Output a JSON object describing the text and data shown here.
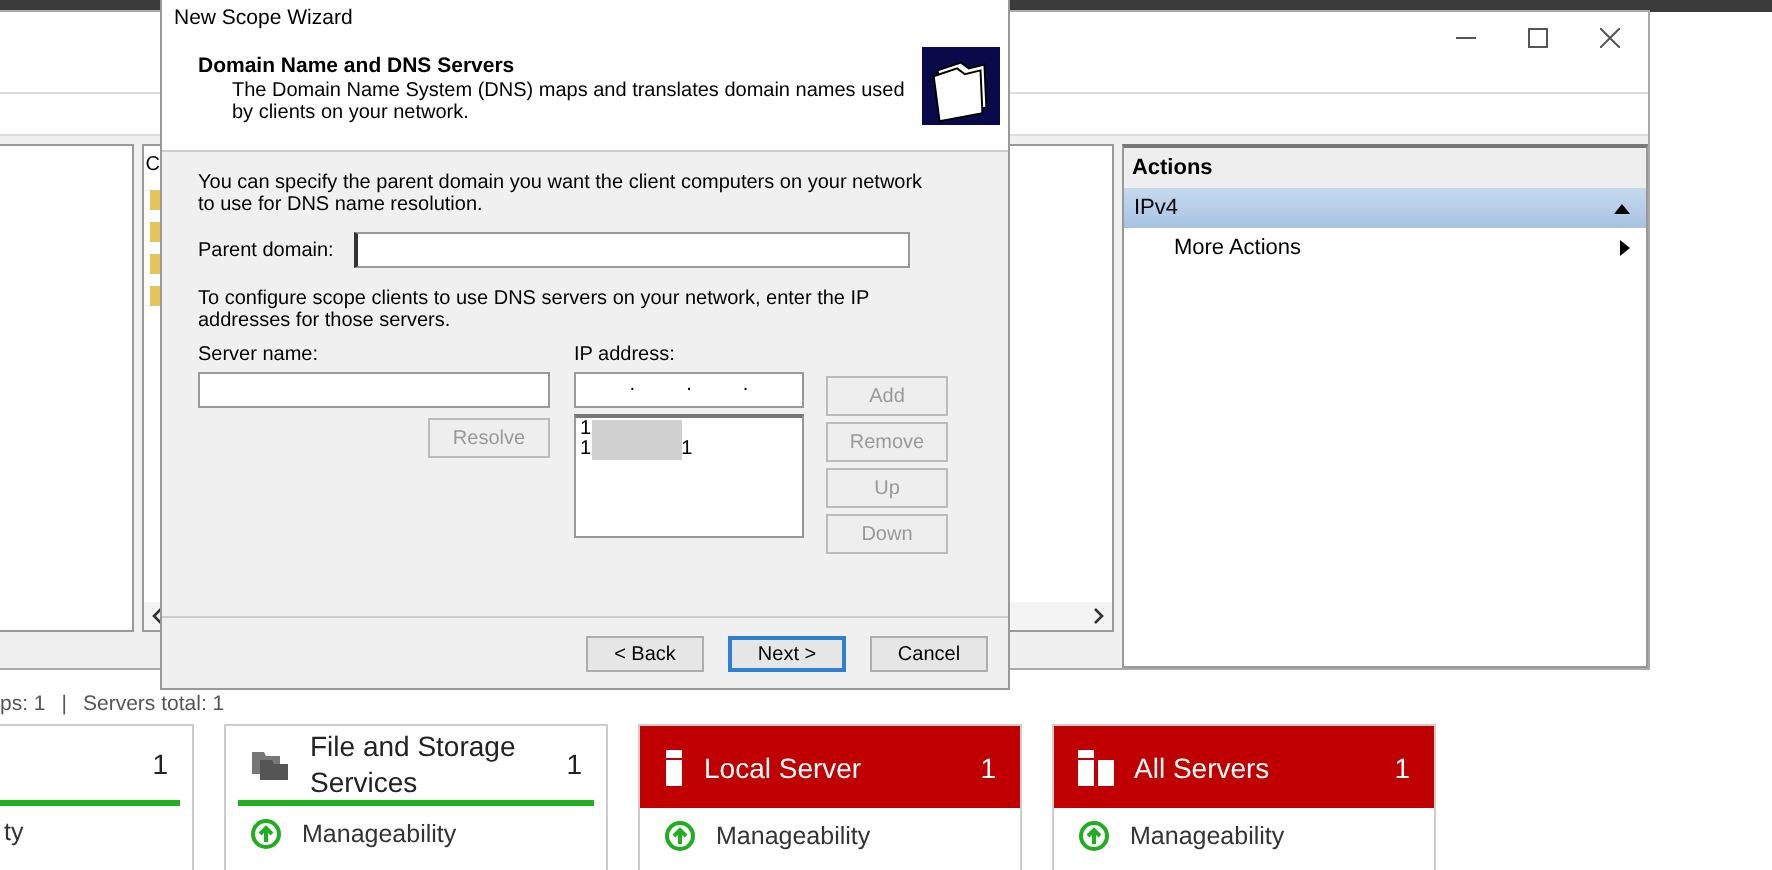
{
  "server_manager": {
    "status_bar": [
      "ps: 1",
      "|",
      "Servers total: 1"
    ],
    "tiles": [
      {
        "kind": "partial",
        "count": "1",
        "alert": false,
        "rows": [
          "ty"
        ]
      },
      {
        "kind": "file-storage",
        "title": "File and Storage Services",
        "count": "1",
        "alert": false,
        "rows": [
          "Manageability"
        ]
      },
      {
        "kind": "local",
        "title": "Local Server",
        "count": "1",
        "alert": true,
        "rows": [
          "Manageability"
        ]
      },
      {
        "kind": "all",
        "title": "All Servers",
        "count": "1",
        "alert": true,
        "rows": [
          "Manageability"
        ]
      }
    ]
  },
  "mmc": {
    "column_1": "C",
    "actions": {
      "title": "Actions",
      "items": [
        {
          "label": "IPv4",
          "kind": "group",
          "selected": true,
          "expanded": true
        },
        {
          "label": "More Actions",
          "kind": "submenu",
          "selected": false
        }
      ]
    }
  },
  "wizard": {
    "title": "New Scope Wizard",
    "heading": "Domain Name and DNS Servers",
    "subheading": "The Domain Name System (DNS) maps and translates domain names used by clients on your network.",
    "intro": "You can specify the parent domain you want the client computers on your network to use for DNS name resolution.",
    "parent_domain": {
      "label": "Parent domain:"
    },
    "servers_intro": "To configure scope clients to use DNS servers on your network, enter the IP addresses for those servers.",
    "server_name": {
      "label": "Server name:"
    },
    "ip_address": {
      "label": "IP address:",
      "separators": [
        ".",
        ".",
        "."
      ]
    },
    "ip_list": [
      {
        "start": "1"
      },
      {
        "start": "1",
        "end": "1"
      }
    ],
    "resolve": {
      "label": "Resolve",
      "disabled": true
    },
    "side_buttons": [
      {
        "label": "Add",
        "disabled": true
      },
      {
        "label": "Remove",
        "disabled": true
      },
      {
        "label": "Up",
        "disabled": true
      },
      {
        "label": "Down",
        "disabled": true
      }
    ],
    "footer_buttons": [
      {
        "label": "< Back",
        "default": false
      },
      {
        "label": "Next >",
        "default": true
      },
      {
        "label": "Cancel",
        "default": false
      }
    ]
  }
}
